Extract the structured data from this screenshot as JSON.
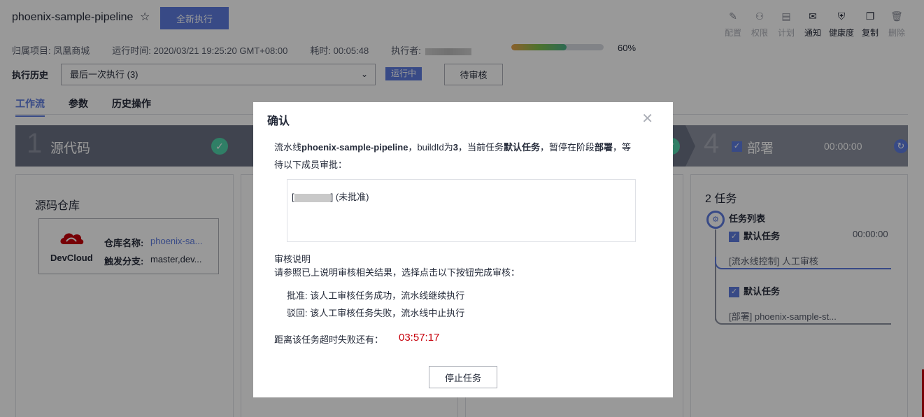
{
  "header": {
    "title": "phoenix-sample-pipeline",
    "run_all_button": "全新执行"
  },
  "toolbar": [
    {
      "label": "配置",
      "icon": "pencil-icon",
      "glyph": "✎",
      "enabled": false
    },
    {
      "label": "权限",
      "icon": "user-permission-icon",
      "glyph": "⚇",
      "enabled": false
    },
    {
      "label": "计划",
      "icon": "calendar-icon",
      "glyph": "▤",
      "enabled": false
    },
    {
      "label": "通知",
      "icon": "mail-icon",
      "glyph": "✉",
      "enabled": true
    },
    {
      "label": "健康度",
      "icon": "health-icon",
      "glyph": "⛨",
      "enabled": true
    },
    {
      "label": "复制",
      "icon": "copy-icon",
      "glyph": "❐",
      "enabled": true
    },
    {
      "label": "删除",
      "icon": "trash-icon",
      "glyph": "🗑",
      "enabled": false
    }
  ],
  "meta": {
    "project": "归属项目: 凤凰商城",
    "run_time": "运行时间: 2020/03/21 19:25:20 GMT+08:00",
    "duration": "耗时: 00:05:48",
    "executor_label": "执行者:",
    "progress_percent": 60,
    "progress_text": "60%"
  },
  "history": {
    "label": "执行历史",
    "selected": "最后一次执行 (3)",
    "status_badge": "运行中",
    "pending_button": "待审核"
  },
  "tabs": [
    "工作流",
    "参数",
    "历史操作"
  ],
  "stages": {
    "first": {
      "num": "1",
      "name": "源代码"
    },
    "last": {
      "num": "4",
      "name": "部署",
      "time": "00:00:00"
    }
  },
  "source_card": {
    "title": "源码仓库",
    "provider": "DevCloud",
    "repo_name_label": "仓库名称:",
    "repo_name_value": "phoenix-sa...",
    "branch_label": "触发分支:",
    "branch_value": "master,dev..."
  },
  "task_panel": {
    "title": "2 任务",
    "list_title": "任务列表",
    "task1_name": "默认任务",
    "task1_time": "00:00:00",
    "task1_sub": "[流水线控制] 人工审核",
    "task2_name": "默认任务",
    "task2_sub": "[部署] phoenix-sample-st..."
  },
  "modal": {
    "title": "确认",
    "desc_1": "流水线",
    "desc_pipeline": "phoenix-sample-pipeline",
    "desc_2": "，buildId为",
    "desc_build": "3",
    "desc_3": "，当前任务",
    "desc_task": "默认任务",
    "desc_4": "，暂停在阶段",
    "desc_stage": "部署",
    "desc_5": "，等待以下成员审批：",
    "approver_suffix": "] (未批准)",
    "review_title": "审核说明",
    "review_body": "请参照已上说明审核相关结果，选择点击以下按钮完成审核：",
    "rule_approve": "批准: 该人工审核任务成功，流水线继续执行",
    "rule_reject": "驳回: 该人工审核任务失败，流水线中止执行",
    "countdown_label": "距离该任务超时失败还有：",
    "countdown": "03:57:17",
    "stop_button": "停止任务"
  }
}
